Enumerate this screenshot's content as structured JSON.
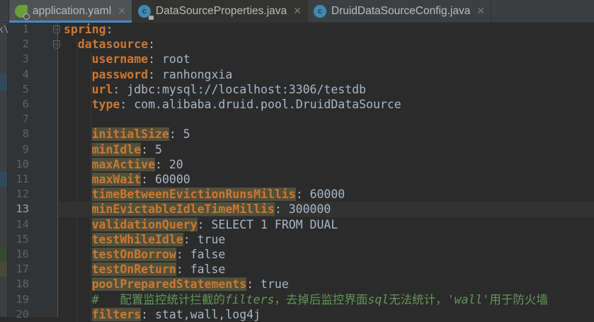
{
  "tabs": [
    {
      "label": "application.yaml",
      "icon": "spring-yaml-icon",
      "active": true
    },
    {
      "label": "DataSourceProperties.java",
      "icon": "java-class-locked-icon",
      "active": false
    },
    {
      "label": "DruidDataSourceConfig.java",
      "icon": "java-class-icon",
      "active": false
    }
  ],
  "left_panel_fragment": "k\\",
  "current_line": 13,
  "colors": {
    "key": "#cc7832",
    "value": "#a9b7c6",
    "comment": "#629755",
    "highlight": "#52503a"
  },
  "lines": [
    {
      "n": 1,
      "indent": 0,
      "key": "spring",
      "value": "",
      "fold": true
    },
    {
      "n": 2,
      "indent": 1,
      "key": "datasource",
      "value": "",
      "fold": true
    },
    {
      "n": 3,
      "indent": 2,
      "key": "username",
      "value": "root"
    },
    {
      "n": 4,
      "indent": 2,
      "key": "password",
      "value": "ranhongxia"
    },
    {
      "n": 5,
      "indent": 2,
      "key": "url",
      "value": "jdbc:mysql://localhost:3306/testdb"
    },
    {
      "n": 6,
      "indent": 2,
      "key": "type",
      "value": "com.alibaba.druid.pool.DruidDataSource"
    },
    {
      "n": 7,
      "indent": 2,
      "key": "",
      "value": ""
    },
    {
      "n": 8,
      "indent": 2,
      "key": "initialSize",
      "value": "5",
      "hl": true
    },
    {
      "n": 9,
      "indent": 2,
      "key": "minIdle",
      "value": "5",
      "hl": true
    },
    {
      "n": 10,
      "indent": 2,
      "key": "maxActive",
      "value": "20",
      "hl": true
    },
    {
      "n": 11,
      "indent": 2,
      "key": "maxWait",
      "value": "60000",
      "hl": true
    },
    {
      "n": 12,
      "indent": 2,
      "key": "timeBetweenEvictionRunsMillis",
      "value": "60000",
      "hl": true
    },
    {
      "n": 13,
      "indent": 2,
      "key": "minEvictableIdleTimeMillis",
      "value": "300000",
      "hl": true
    },
    {
      "n": 14,
      "indent": 2,
      "key": "validationQuery",
      "value": "SELECT 1 FROM DUAL",
      "hl": true
    },
    {
      "n": 15,
      "indent": 2,
      "key": "testWhileIdle",
      "value": "true",
      "hl": true
    },
    {
      "n": 16,
      "indent": 2,
      "key": "testOnBorrow",
      "value": "false",
      "hl": true
    },
    {
      "n": 17,
      "indent": 2,
      "key": "testOnReturn",
      "value": "false",
      "hl": true
    },
    {
      "n": 18,
      "indent": 2,
      "key": "poolPreparedStatements",
      "value": "true",
      "hl": true
    },
    {
      "n": 19,
      "indent": 2,
      "comment": [
        [
          "#   配置监控统计拦截的",
          false
        ],
        [
          "filters",
          true
        ],
        [
          "，去掉后监控界面",
          false
        ],
        [
          "sql",
          true
        ],
        [
          "无法统计，",
          false
        ],
        [
          "'wall'",
          true
        ],
        [
          "用于防火墙",
          false
        ]
      ]
    },
    {
      "n": 20,
      "indent": 2,
      "key": "filters",
      "value": "stat,wall,log4j",
      "hl": true
    }
  ]
}
